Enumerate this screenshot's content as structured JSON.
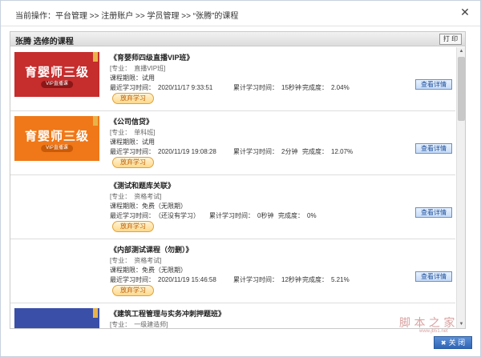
{
  "breadcrumb": {
    "prefix": "当前操作：",
    "items": [
      "平台管理",
      "注册账户",
      "学员管理",
      "“张腾”的课程"
    ],
    "separator": " >> "
  },
  "panel": {
    "title": "张腾 选修的课程",
    "print_label": "打 印"
  },
  "courses": [
    {
      "thumb_title": "育婴师三级",
      "thumb_sub": "VIP直播课",
      "thumb_color": "#c62d2d",
      "name": "《育婴师四级直播VIP班》",
      "major": "[专业：　直播VIP班]",
      "period": "课程期限：试用",
      "last_study": "最近学习时间：　2020/11/17 9:33:51",
      "total_time": "累计学习时间：　15秒钟",
      "progress": "完成度：　2.04%",
      "quit_label": "放弃学习",
      "detail_label": "查看详情"
    },
    {
      "thumb_title": "育婴师三级",
      "thumb_sub": "VIP直播课",
      "thumb_color": "#f07818",
      "name": "《公司信贷》",
      "major": "[专业：　单科班]",
      "period": "课程期限：试用",
      "last_study": "最近学习时间：　2020/11/19 19:08:28",
      "total_time": "累计学习时间：　2分钟",
      "progress": "完成度：　12.07%",
      "quit_label": "放弃学习",
      "detail_label": "查看详情"
    },
    {
      "thumb_title": "",
      "thumb_sub": "",
      "thumb_color": "#ececec",
      "name": "《测试和题库关联》",
      "major": "[专业：　资格考试]",
      "period": "课程期限：免费（无限期）",
      "last_study": "最近学习时间：　（还没有学习）",
      "total_time": "累计学习时间：　0秒钟",
      "progress": "完成度：　0%",
      "quit_label": "放弃学习",
      "detail_label": "查看详情"
    },
    {
      "thumb_title": "",
      "thumb_sub": "",
      "thumb_color": "#ececec",
      "name": "《内部测试课程（勿删）》",
      "major": "[专业：　资格考试]",
      "period": "课程期限：免费（无限期）",
      "last_study": "最近学习时间：　2020/11/19 15:46:58",
      "total_time": "累计学习时间：　12秒钟",
      "progress": "完成度：　5.21%",
      "quit_label": "放弃学习",
      "detail_label": "查看详情"
    },
    {
      "thumb_title": "",
      "thumb_sub": "",
      "thumb_color": "#3a4fa8",
      "name": "《建筑工程管理与实务冲刺押题班》",
      "major": "[专业：　一级建造师]",
      "period": "",
      "last_study": "",
      "total_time": "",
      "progress": "",
      "quit_label": "",
      "detail_label": ""
    }
  ],
  "footer": {
    "close_label": "关 闭"
  },
  "watermark": {
    "text": "脚 本 之 家",
    "url": "www.jb51.net"
  }
}
